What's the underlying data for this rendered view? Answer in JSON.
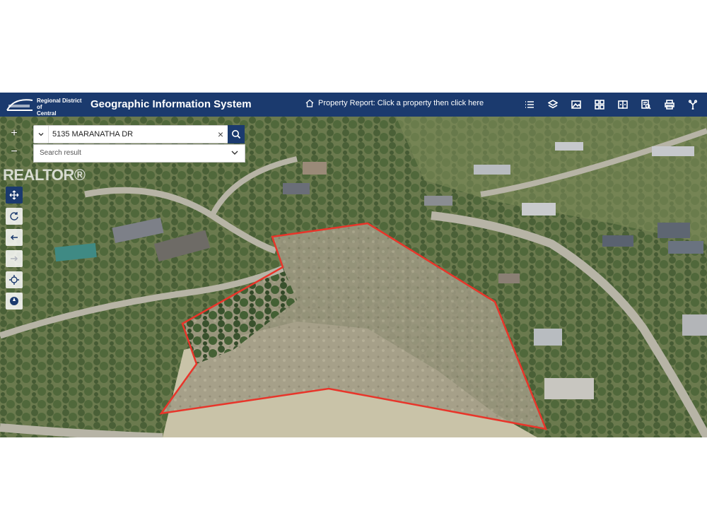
{
  "header": {
    "org_line1": "Regional District of",
    "org_line2": "Central Okanagan",
    "title": "Geographic Information System",
    "property_report": "Property Report: Click a property then click here"
  },
  "toolbar_icons": [
    "list-icon",
    "layers-icon",
    "basemap-icon",
    "grid-icon",
    "compare-icon",
    "identify-icon",
    "print-icon",
    "tools-icon"
  ],
  "search": {
    "value": "5135 MARANATHA DR",
    "clear_symbol": "×",
    "result_label": "Search result"
  },
  "map_controls": {
    "zoom_in": "+",
    "zoom_out": "−"
  },
  "watermark": "REALTOR®",
  "colors": {
    "header_bg": "#1b3a6e",
    "boundary": "#e8352a"
  }
}
